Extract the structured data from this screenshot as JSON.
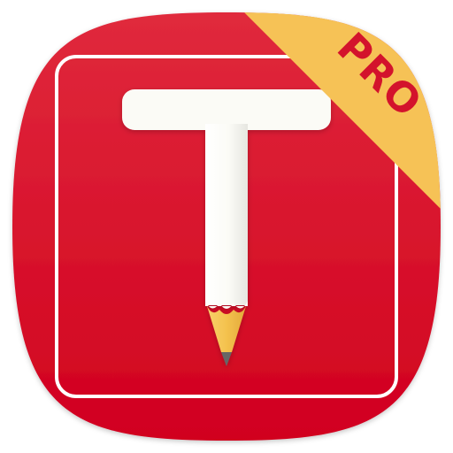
{
  "app_icon": {
    "badge_label": "PRO",
    "glyph_letter": "T",
    "icon_name": "pencil-t-icon"
  },
  "colors": {
    "background_top": "#e02a3c",
    "background_bottom": "#d1001f",
    "frame_stroke": "#ffffff",
    "letter_fill": "#fbfbf6",
    "ribbon_fill": "#f6c256",
    "ribbon_text": "#d3132c",
    "pencil_wood": "#f4c24e",
    "pencil_lead": "#666666"
  }
}
